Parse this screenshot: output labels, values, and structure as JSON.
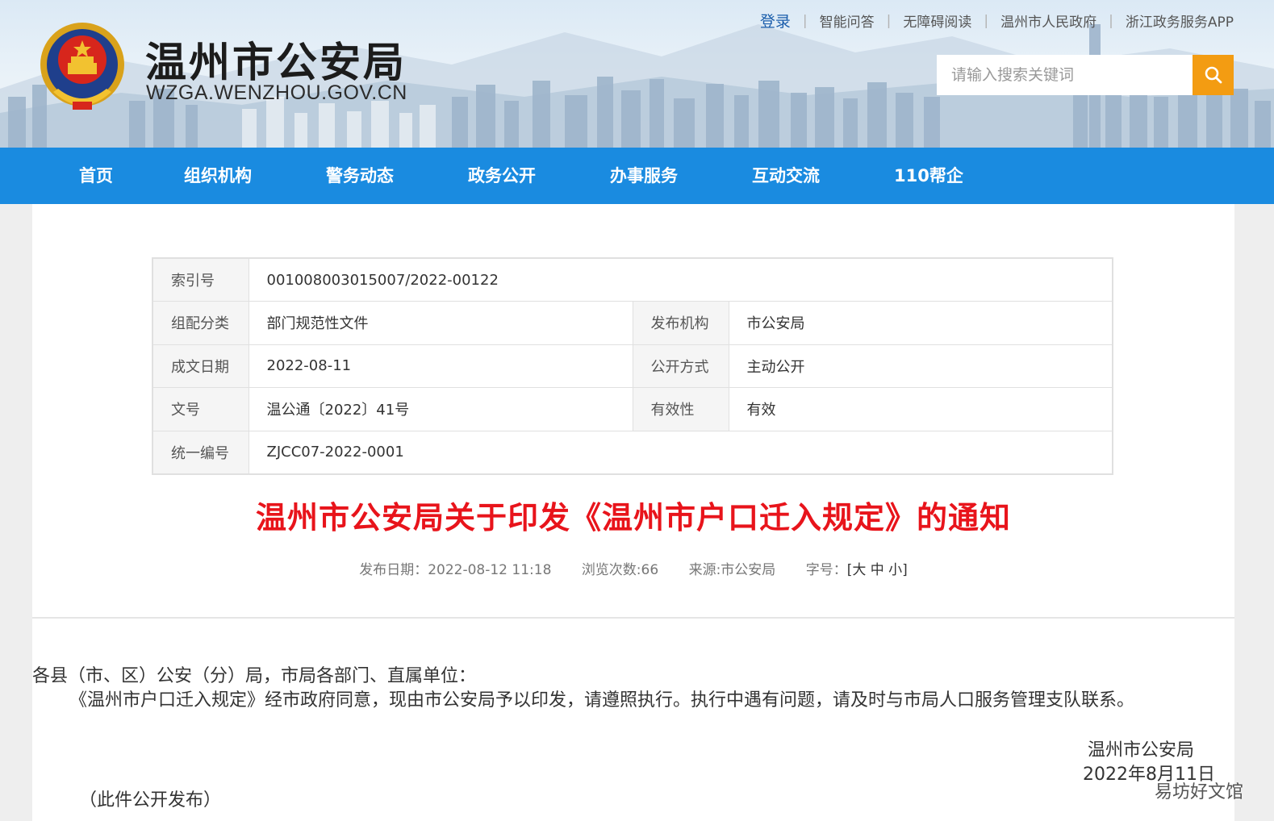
{
  "header": {
    "site_title": "温州市公安局",
    "site_domain": "WZGA.WENZHOU.GOV.CN",
    "top_links": [
      {
        "label": "登录",
        "name": "login-link"
      },
      {
        "label": "智能问答",
        "name": "smart-qa-link"
      },
      {
        "label": "无障碍阅读",
        "name": "accessibility-link"
      },
      {
        "label": "温州市人民政府",
        "name": "wenzhou-gov-link"
      },
      {
        "label": "浙江政务服务APP",
        "name": "zj-app-link"
      }
    ],
    "search_placeholder": "请输入搜索关键词"
  },
  "nav": {
    "items": [
      "首页",
      "组织机构",
      "警务动态",
      "政务公开",
      "办事服务",
      "互动交流",
      "110帮企"
    ]
  },
  "meta_table": {
    "index_label": "索引号",
    "index_value": "001008003015007/2022-00122",
    "category_label": "组配分类",
    "category_value": "部门规范性文件",
    "publisher_label": "发布机构",
    "publisher_value": "市公安局",
    "date_label": "成文日期",
    "date_value": "2022-08-11",
    "open_label": "公开方式",
    "open_value": "主动公开",
    "docno_label": "文号",
    "docno_value": "温公通〔2022〕41号",
    "valid_label": "有效性",
    "valid_value": "有效",
    "uid_label": "统一编号",
    "uid_value": "ZJCC07-2022-0001"
  },
  "article": {
    "title": "温州市公安局关于印发《温州市户口迁入规定》的通知",
    "publish_date": "发布日期：2022-08-12 11:18",
    "views": "浏览次数:66",
    "source": "来源:市公安局",
    "font_size_label": "字号：",
    "font_size_options": "[大 中 小]",
    "salutation": "各县（市、区）公安（分）局，市局各部门、直属单位：",
    "paragraph": "《温州市户口迁入规定》经市政府同意，现由市公安局予以印发，请遵照执行。执行中遇有问题，请及时与市局人口服务管理支队联系。",
    "sign_org": "温州市公安局",
    "sign_date": "2022年8月11日",
    "note": "（此件公开发布）"
  },
  "watermark": "易坊好文馆",
  "colors": {
    "nav_blue": "#1a8be0",
    "title_red": "#e8141b",
    "search_orange": "#f39c12",
    "login_blue": "#1a5dab"
  }
}
